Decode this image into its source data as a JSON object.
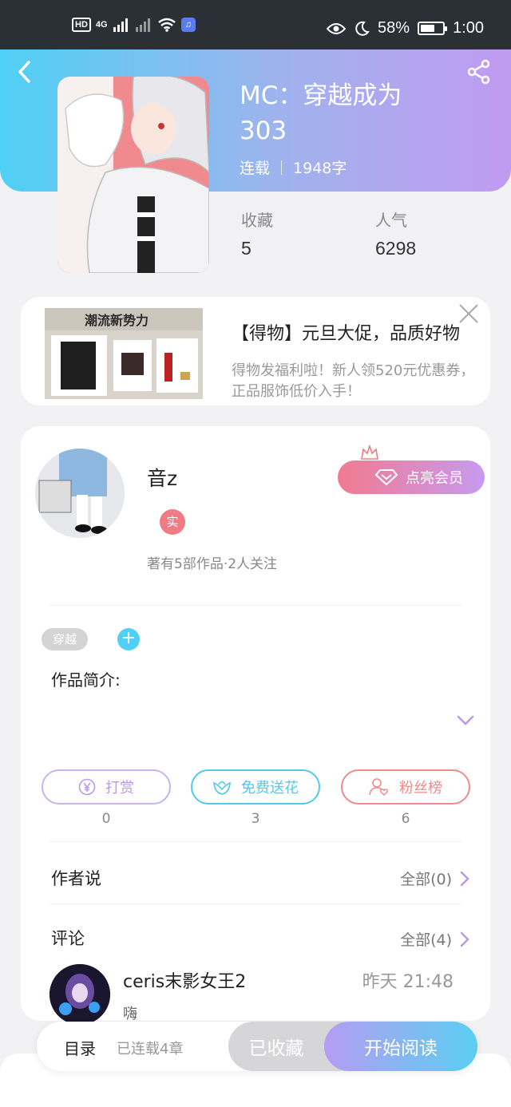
{
  "status_bar": {
    "left_badges": [
      "HD",
      "4G"
    ],
    "battery": "58%",
    "time": "1:00",
    "icons": [
      "eye-icon",
      "moon-icon",
      "battery-icon",
      "wifi-icon",
      "signal-icon"
    ]
  },
  "book": {
    "title": "MC：穿越成为303",
    "status": "连载",
    "word_count": "1948字",
    "stats": [
      {
        "label": "收藏",
        "value": "5"
      },
      {
        "label": "人气",
        "value": "6298"
      }
    ]
  },
  "ad": {
    "title": "【得物】元旦大促，品质好物",
    "description": "得物发福利啦！新人领520元优惠券，正品服饰低价入手！",
    "image_text": "潮流新势力"
  },
  "author": {
    "name": "音z",
    "badge": "实",
    "meta": "著有5部作品·2人关注",
    "vip_button": "点亮会员"
  },
  "tags": [
    "穿越"
  ],
  "intro_label": "作品简介:",
  "actions": [
    {
      "label": "打赏",
      "count": "0",
      "color": "#b99ae6"
    },
    {
      "label": "免费送花",
      "count": "3",
      "color": "#4fcbe8"
    },
    {
      "label": "粉丝榜",
      "count": "6",
      "color": "#ee8b8b"
    }
  ],
  "author_says": {
    "label": "作者说",
    "link": "全部(0)"
  },
  "comments": {
    "label": "评论",
    "link": "全部(4)",
    "items": [
      {
        "user": "ceris末影女王2",
        "time": "昨天 21:48",
        "text": "嗨"
      }
    ]
  },
  "bottom_bar": {
    "toc": "目录",
    "chapters": "已连载4章",
    "favorited": "已收藏",
    "start_reading": "开始阅读"
  },
  "colors": {
    "header_gradient_start": "#4fd0f4",
    "header_gradient_end": "#c19bf0",
    "accent_blue": "#4fd0f4",
    "accent_pink": "#f07b85"
  }
}
